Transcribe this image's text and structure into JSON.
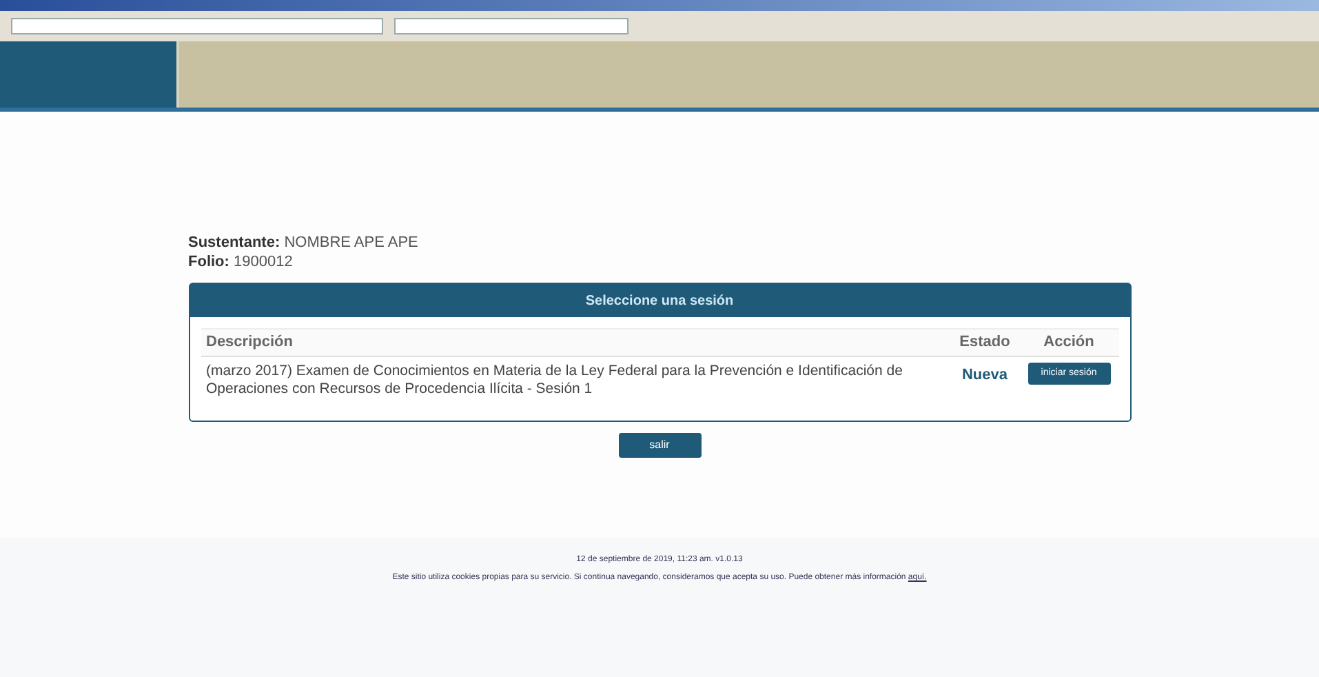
{
  "candidate": {
    "label": "Sustentante:",
    "value": "NOMBRE APE APE"
  },
  "folio": {
    "label": "Folio:",
    "value": "1900012"
  },
  "panel": {
    "title": "Seleccione una sesión",
    "columns": [
      "Descripción",
      "Estado",
      "Acción"
    ],
    "rows": [
      {
        "description": "(marzo 2017) Examen de Conocimientos en Materia de la Ley Federal para la Prevención e Identificación de Operaciones con Recursos de Procedencia Ilícita - Sesión 1",
        "status": "Nueva",
        "action": "iniciar sesión"
      }
    ]
  },
  "exit_button": "salir",
  "footer": {
    "timestamp": "12 de septiembre de 2019, 11:23 am. v1.0.13",
    "notice": "Este sitio utiliza cookies propias para su servicio. Si continua navegando, consideramos que acepta su uso. Puede obtener más información",
    "link": "aquí."
  }
}
